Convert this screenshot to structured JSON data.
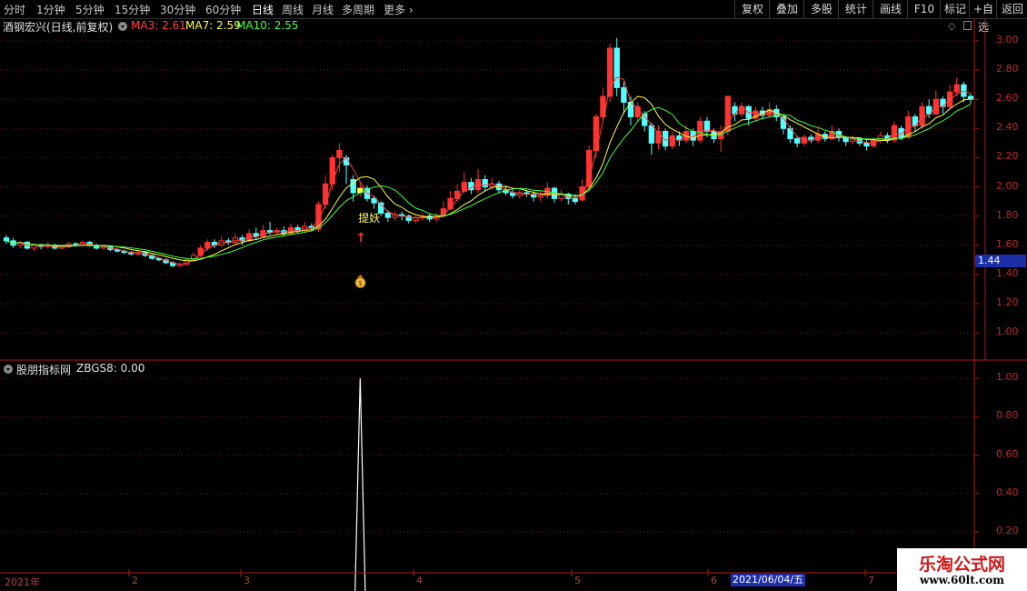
{
  "toolbar": {
    "periods": [
      "分时",
      "1分钟",
      "5分钟",
      "15分钟",
      "30分钟",
      "60分钟",
      "日线",
      "周线",
      "月线",
      "多周期",
      "更多"
    ],
    "active": "日线",
    "right_buttons": [
      "复权",
      "叠加",
      "多股",
      "统计",
      "画线",
      "F10",
      "标记",
      "+自选",
      "返回"
    ]
  },
  "main": {
    "title": "酒钢宏兴(日线,前复权)",
    "ma3_label": "MA3: 2.61",
    "ma7_label": "MA7: 2.59",
    "ma10_label": "MA10: 2.55",
    "signal_text": "提妖",
    "price_tag": "1.44",
    "y_ticks": [
      "3.00",
      "2.80",
      "2.60",
      "2.40",
      "2.20",
      "2.00",
      "1.80",
      "1.60",
      "1.40",
      "1.20",
      "1.00"
    ]
  },
  "indicator": {
    "title": "股朋指标网",
    "value_label": "ZBGS8: 0.00",
    "y_ticks": [
      "1.00",
      "0.80",
      "0.60",
      "0.40",
      "0.20"
    ]
  },
  "dates": {
    "labels": [
      "2021年",
      "2",
      "3",
      "4",
      "5",
      "6",
      "7"
    ],
    "selected": "2021/06/04/五"
  },
  "watermark": {
    "line1": "乐淘公式网",
    "line2": "www.60lt.com"
  },
  "colors": {
    "up": "#ff3232",
    "down": "#54ffff",
    "ma3": "#ff4040",
    "ma7": "#ffff40",
    "ma10": "#40ff40",
    "axis": "#b01818",
    "grid": "#7a0f0f"
  },
  "chart_data": [
    {
      "type": "candlestick",
      "title": "酒钢宏兴(日线,前复权)",
      "ylim": [
        0.9,
        3.05
      ],
      "y_ticks": [
        3.0,
        2.8,
        2.6,
        2.4,
        2.2,
        2.0,
        1.8,
        1.6,
        1.4,
        1.2,
        1.0
      ],
      "series": [
        {
          "name": "MA3",
          "last": 2.61
        },
        {
          "name": "MA7",
          "last": 2.59
        },
        {
          "name": "MA10",
          "last": 2.55
        }
      ],
      "candles": [
        [
          1.65,
          1.63,
          1.67,
          1.61
        ],
        [
          1.63,
          1.6,
          1.65,
          1.58
        ],
        [
          1.6,
          1.62,
          1.63,
          1.58
        ],
        [
          1.62,
          1.58,
          1.63,
          1.57
        ],
        [
          1.58,
          1.6,
          1.61,
          1.56
        ],
        [
          1.6,
          1.59,
          1.61,
          1.57
        ],
        [
          1.59,
          1.6,
          1.62,
          1.58
        ],
        [
          1.6,
          1.58,
          1.61,
          1.57
        ],
        [
          1.58,
          1.59,
          1.6,
          1.57
        ],
        [
          1.59,
          1.61,
          1.62,
          1.58
        ],
        [
          1.61,
          1.6,
          1.62,
          1.59
        ],
        [
          1.6,
          1.62,
          1.63,
          1.59
        ],
        [
          1.62,
          1.6,
          1.63,
          1.59
        ],
        [
          1.6,
          1.58,
          1.61,
          1.57
        ],
        [
          1.58,
          1.59,
          1.6,
          1.57
        ],
        [
          1.59,
          1.57,
          1.6,
          1.56
        ],
        [
          1.57,
          1.56,
          1.58,
          1.55
        ],
        [
          1.56,
          1.55,
          1.57,
          1.54
        ],
        [
          1.55,
          1.54,
          1.56,
          1.53
        ],
        [
          1.54,
          1.55,
          1.56,
          1.53
        ],
        [
          1.55,
          1.53,
          1.56,
          1.52
        ],
        [
          1.53,
          1.51,
          1.54,
          1.5
        ],
        [
          1.51,
          1.5,
          1.52,
          1.49
        ],
        [
          1.5,
          1.48,
          1.51,
          1.47
        ],
        [
          1.48,
          1.46,
          1.49,
          1.45
        ],
        [
          1.46,
          1.47,
          1.48,
          1.45
        ],
        [
          1.47,
          1.5,
          1.51,
          1.46
        ],
        [
          1.5,
          1.53,
          1.55,
          1.49
        ],
        [
          1.53,
          1.58,
          1.6,
          1.52
        ],
        [
          1.58,
          1.62,
          1.64,
          1.56
        ],
        [
          1.62,
          1.6,
          1.64,
          1.58
        ],
        [
          1.6,
          1.63,
          1.66,
          1.59
        ],
        [
          1.63,
          1.62,
          1.65,
          1.6
        ],
        [
          1.62,
          1.65,
          1.68,
          1.61
        ],
        [
          1.65,
          1.63,
          1.67,
          1.6
        ],
        [
          1.63,
          1.68,
          1.71,
          1.62
        ],
        [
          1.68,
          1.66,
          1.72,
          1.64
        ],
        [
          1.66,
          1.7,
          1.74,
          1.65
        ],
        [
          1.7,
          1.69,
          1.76,
          1.67
        ],
        [
          1.69,
          1.7,
          1.72,
          1.67
        ],
        [
          1.7,
          1.68,
          1.73,
          1.66
        ],
        [
          1.68,
          1.72,
          1.75,
          1.67
        ],
        [
          1.72,
          1.7,
          1.74,
          1.68
        ],
        [
          1.7,
          1.73,
          1.76,
          1.69
        ],
        [
          1.73,
          1.72,
          1.75,
          1.7
        ],
        [
          1.71,
          1.88,
          1.9,
          1.69
        ],
        [
          1.88,
          2.02,
          2.08,
          1.85
        ],
        [
          2.02,
          2.2,
          2.22,
          1.98
        ],
        [
          2.2,
          2.25,
          2.3,
          2.1
        ],
        [
          2.2,
          2.15,
          2.22,
          2.02
        ],
        [
          2.05,
          1.96,
          2.08,
          1.9
        ],
        [
          1.96,
          1.99,
          2.03,
          1.93
        ],
        [
          1.99,
          1.92,
          2.01,
          1.9
        ],
        [
          1.92,
          1.89,
          1.94,
          1.85
        ],
        [
          1.89,
          1.82,
          1.9,
          1.8
        ],
        [
          1.82,
          1.79,
          1.84,
          1.76
        ],
        [
          1.79,
          1.81,
          1.83,
          1.77
        ],
        [
          1.81,
          1.8,
          1.83,
          1.77
        ],
        [
          1.8,
          1.77,
          1.81,
          1.75
        ],
        [
          1.77,
          1.79,
          1.8,
          1.75
        ],
        [
          1.79,
          1.8,
          1.82,
          1.77
        ],
        [
          1.8,
          1.78,
          1.82,
          1.76
        ],
        [
          1.78,
          1.8,
          1.82,
          1.76
        ],
        [
          1.8,
          1.85,
          1.9,
          1.79
        ],
        [
          1.85,
          1.92,
          1.97,
          1.84
        ],
        [
          1.92,
          1.97,
          2.02,
          1.9
        ],
        [
          1.97,
          2.03,
          2.1,
          1.96
        ],
        [
          2.03,
          1.98,
          2.06,
          1.95
        ],
        [
          1.98,
          2.05,
          2.12,
          1.96
        ],
        [
          2.05,
          2.0,
          2.08,
          1.97
        ],
        [
          2.0,
          2.02,
          2.06,
          1.98
        ],
        [
          2.02,
          1.98,
          2.04,
          1.96
        ],
        [
          1.98,
          1.96,
          2.01,
          1.94
        ],
        [
          1.96,
          1.94,
          1.98,
          1.92
        ],
        [
          1.94,
          1.96,
          1.98,
          1.92
        ],
        [
          1.96,
          1.95,
          1.98,
          1.93
        ],
        [
          1.95,
          1.93,
          1.97,
          1.9
        ],
        [
          1.93,
          1.94,
          1.97,
          1.9
        ],
        [
          1.94,
          1.99,
          2.03,
          1.92
        ],
        [
          1.99,
          1.92,
          2.0,
          1.89
        ],
        [
          1.92,
          1.95,
          1.98,
          1.9
        ],
        [
          1.95,
          1.92,
          1.96,
          1.88
        ],
        [
          1.92,
          1.9,
          1.95,
          1.88
        ],
        [
          1.91,
          2.0,
          2.05,
          1.9
        ],
        [
          2.0,
          2.25,
          2.28,
          1.98
        ],
        [
          2.25,
          2.48,
          2.5,
          2.2
        ],
        [
          2.48,
          2.62,
          2.68,
          2.45
        ],
        [
          2.62,
          2.95,
          2.98,
          2.58
        ],
        [
          2.95,
          2.68,
          3.02,
          2.62
        ],
        [
          2.68,
          2.58,
          2.72,
          2.5
        ],
        [
          2.58,
          2.48,
          2.62,
          2.42
        ],
        [
          2.48,
          2.55,
          2.58,
          2.45
        ],
        [
          2.5,
          2.42,
          2.52,
          2.38
        ],
        [
          2.42,
          2.3,
          2.44,
          2.22
        ],
        [
          2.3,
          2.38,
          2.42,
          2.26
        ],
        [
          2.38,
          2.28,
          2.4,
          2.25
        ],
        [
          2.28,
          2.35,
          2.38,
          2.26
        ],
        [
          2.35,
          2.32,
          2.38,
          2.28
        ],
        [
          2.32,
          2.38,
          2.42,
          2.3
        ],
        [
          2.38,
          2.32,
          2.4,
          2.28
        ],
        [
          2.32,
          2.45,
          2.48,
          2.3
        ],
        [
          2.45,
          2.38,
          2.48,
          2.34
        ],
        [
          2.38,
          2.33,
          2.4,
          2.3
        ],
        [
          2.33,
          2.38,
          2.42,
          2.24
        ],
        [
          2.38,
          2.62,
          2.62,
          2.35
        ],
        [
          2.55,
          2.5,
          2.58,
          2.45
        ],
        [
          2.5,
          2.55,
          2.58,
          2.48
        ],
        [
          2.55,
          2.47,
          2.56,
          2.42
        ],
        [
          2.47,
          2.52,
          2.55,
          2.45
        ],
        [
          2.52,
          2.49,
          2.55,
          2.46
        ],
        [
          2.49,
          2.53,
          2.58,
          2.48
        ],
        [
          2.53,
          2.48,
          2.56,
          2.45
        ],
        [
          2.48,
          2.4,
          2.5,
          2.36
        ],
        [
          2.4,
          2.33,
          2.42,
          2.3
        ],
        [
          2.33,
          2.3,
          2.35,
          2.27
        ],
        [
          2.3,
          2.34,
          2.36,
          2.28
        ],
        [
          2.34,
          2.32,
          2.36,
          2.3
        ],
        [
          2.32,
          2.36,
          2.4,
          2.3
        ],
        [
          2.36,
          2.33,
          2.38,
          2.31
        ],
        [
          2.33,
          2.38,
          2.42,
          2.32
        ],
        [
          2.38,
          2.34,
          2.4,
          2.31
        ],
        [
          2.34,
          2.31,
          2.35,
          2.28
        ],
        [
          2.31,
          2.33,
          2.35,
          2.29
        ],
        [
          2.33,
          2.3,
          2.34,
          2.28
        ],
        [
          2.3,
          2.28,
          2.32,
          2.25
        ],
        [
          2.28,
          2.32,
          2.34,
          2.27
        ],
        [
          2.32,
          2.35,
          2.38,
          2.3
        ],
        [
          2.35,
          2.32,
          2.37,
          2.3
        ],
        [
          2.32,
          2.42,
          2.45,
          2.3
        ],
        [
          2.4,
          2.34,
          2.42,
          2.32
        ],
        [
          2.34,
          2.48,
          2.52,
          2.33
        ],
        [
          2.48,
          2.42,
          2.5,
          2.38
        ],
        [
          2.42,
          2.55,
          2.58,
          2.4
        ],
        [
          2.55,
          2.5,
          2.6,
          2.47
        ],
        [
          2.5,
          2.6,
          2.66,
          2.49
        ],
        [
          2.6,
          2.55,
          2.62,
          2.5
        ],
        [
          2.55,
          2.65,
          2.7,
          2.53
        ],
        [
          2.65,
          2.7,
          2.75,
          2.62
        ],
        [
          2.7,
          2.62,
          2.72,
          2.58
        ],
        [
          2.62,
          2.6,
          2.64,
          2.57
        ]
      ],
      "signal_index": 51
    },
    {
      "type": "line",
      "title": "股朋指标网",
      "ylim": [
        0,
        1.05
      ],
      "y_ticks": [
        1.0,
        0.8,
        0.6,
        0.4,
        0.2
      ],
      "series": [
        {
          "name": "ZBGS8",
          "spike_index": 51,
          "spike_value": 1.0,
          "base_value": 0.0,
          "last": 0.0
        }
      ]
    }
  ]
}
